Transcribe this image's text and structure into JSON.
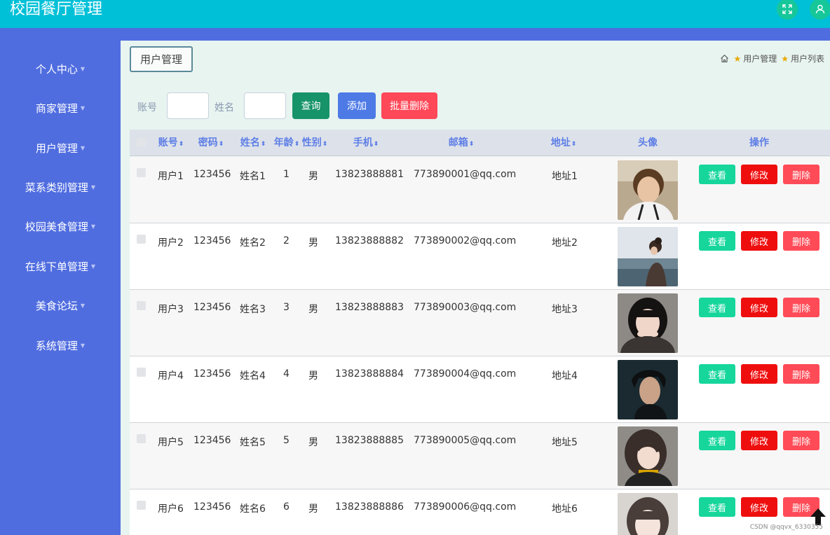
{
  "app": {
    "title": "校园餐厅管理"
  },
  "sidebar": {
    "items": [
      {
        "label": "个人中心"
      },
      {
        "label": "商家管理"
      },
      {
        "label": "用户管理"
      },
      {
        "label": "菜系类别管理"
      },
      {
        "label": "校园美食管理"
      },
      {
        "label": "在线下单管理"
      },
      {
        "label": "美食论坛"
      },
      {
        "label": "系统管理"
      }
    ]
  },
  "page": {
    "tag": "用户管理"
  },
  "breadcrumb": {
    "items": [
      "用户管理",
      "用户列表"
    ]
  },
  "search": {
    "account_label": "账号",
    "name_label": "姓名",
    "account_value": "",
    "name_value": "",
    "query_label": "查询",
    "add_label": "添加",
    "batch_delete_label": "批量删除"
  },
  "table": {
    "headers": {
      "account": "账号",
      "password": "密码",
      "name": "姓名",
      "age": "年龄",
      "gender": "性别",
      "phone": "手机",
      "email": "邮箱",
      "address": "地址",
      "avatar": "头像",
      "actions": "操作"
    },
    "action_labels": {
      "view": "查看",
      "edit": "修改",
      "delete": "删除"
    },
    "rows": [
      {
        "account": "用户1",
        "password": "123456",
        "name": "姓名1",
        "age": "1",
        "gender": "男",
        "phone": "13823888881",
        "email": "773890001@qq.com",
        "address": "地址1"
      },
      {
        "account": "用户2",
        "password": "123456",
        "name": "姓名2",
        "age": "2",
        "gender": "男",
        "phone": "13823888882",
        "email": "773890002@qq.com",
        "address": "地址2"
      },
      {
        "account": "用户3",
        "password": "123456",
        "name": "姓名3",
        "age": "3",
        "gender": "男",
        "phone": "13823888883",
        "email": "773890003@qq.com",
        "address": "地址3"
      },
      {
        "account": "用户4",
        "password": "123456",
        "name": "姓名4",
        "age": "4",
        "gender": "男",
        "phone": "13823888884",
        "email": "773890004@qq.com",
        "address": "地址4"
      },
      {
        "account": "用户5",
        "password": "123456",
        "name": "姓名5",
        "age": "5",
        "gender": "男",
        "phone": "13823888885",
        "email": "773890005@qq.com",
        "address": "地址5"
      },
      {
        "account": "用户6",
        "password": "123456",
        "name": "姓名6",
        "age": "6",
        "gender": "男",
        "phone": "13823888886",
        "email": "773890006@qq.com",
        "address": "地址6"
      }
    ]
  },
  "watermark": "CSDN @qqvx_6330355",
  "colors": {
    "topbar": "#00c0d8",
    "sidebar": "#506de0",
    "view_button": "#16d69c",
    "edit_button": "#ef0e0e",
    "delete_button": "#ff4b57",
    "header_text": "#5e7ee6"
  },
  "icons": {
    "fullscreen": "expand-icon",
    "user": "user-icon",
    "home": "home-icon",
    "breadcrumb_separator": "star-icon",
    "sort": "sort-icon",
    "back_to_top": "arrow-up-icon"
  }
}
